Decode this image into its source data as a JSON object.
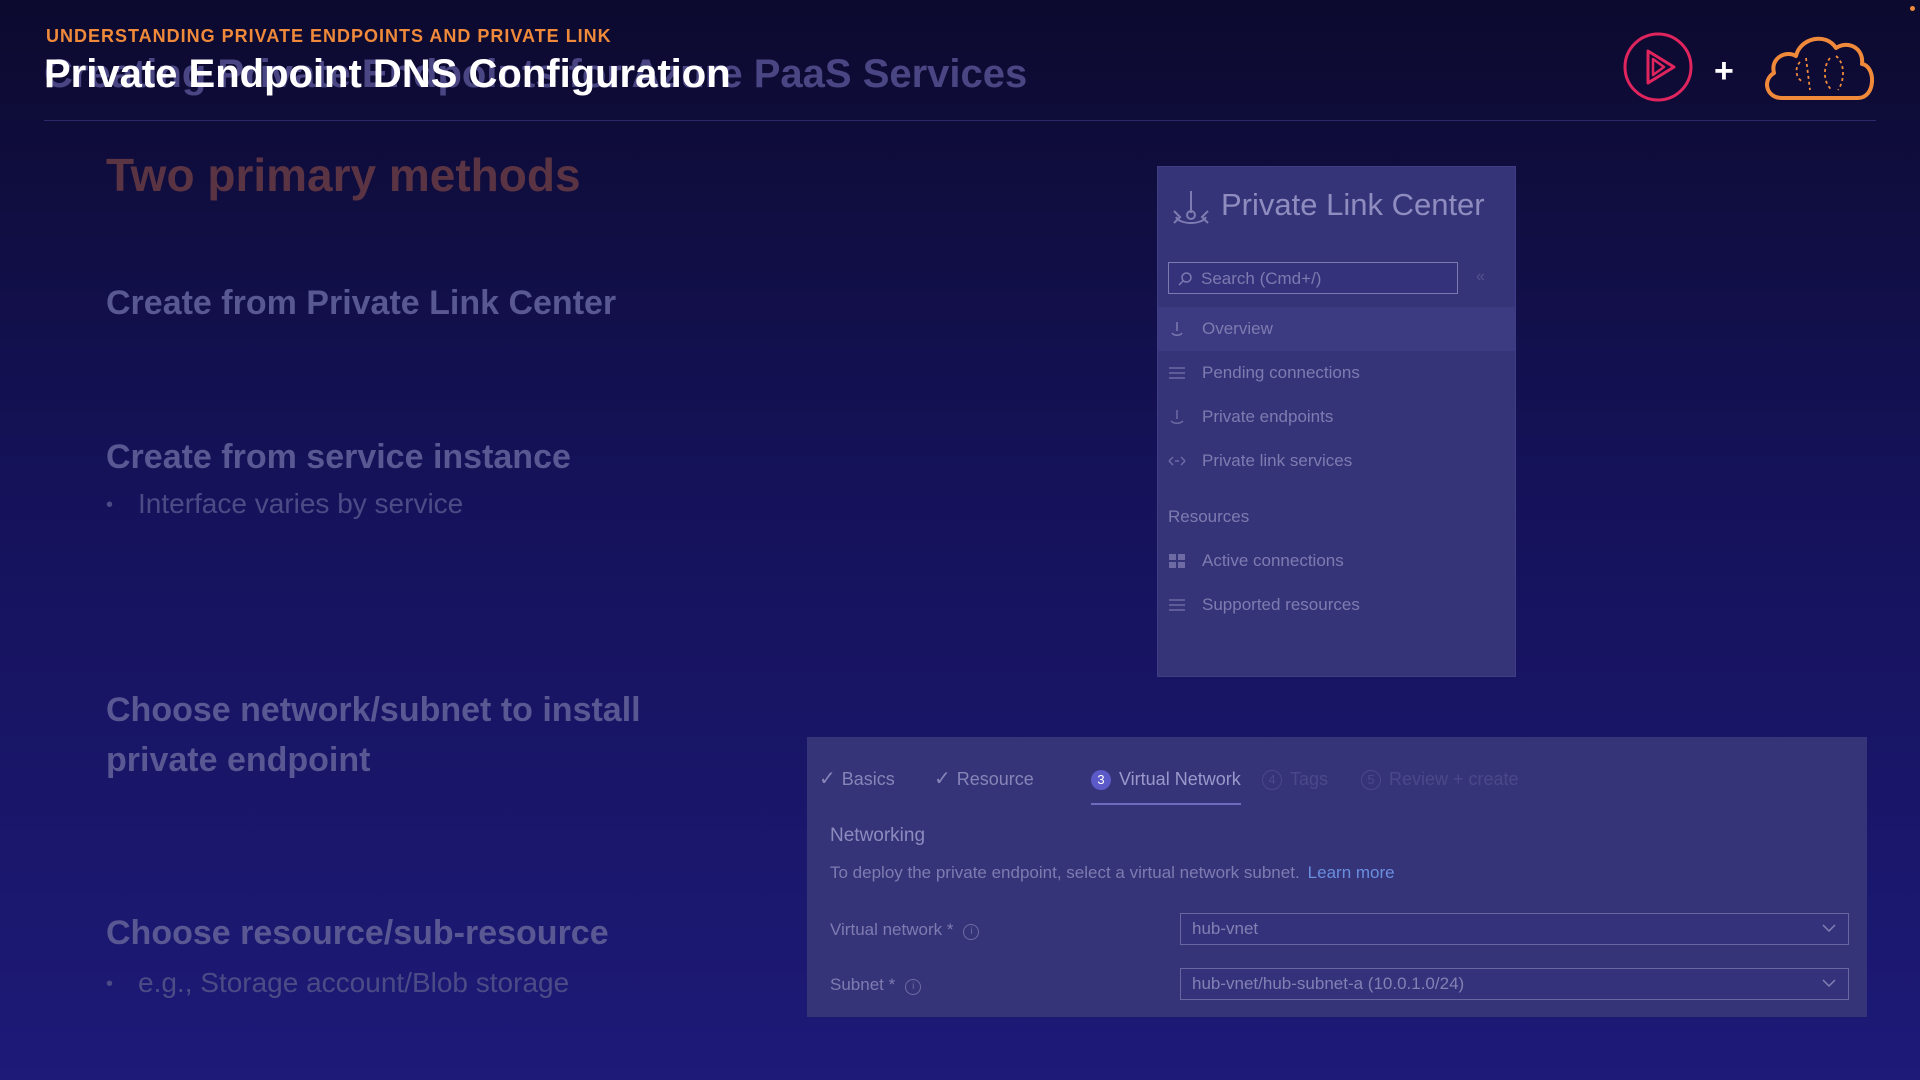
{
  "header": {
    "eyebrow": "UNDERSTANDING PRIVATE ENDPOINTS AND PRIVATE LINK",
    "title_ghost": "Creating Private Endpoints for Azure PaaS Services",
    "title": "Private Endpoint DNS Configuration"
  },
  "logos": [
    "play-logo-icon",
    "plus-icon",
    "cloud-brain-icon"
  ],
  "slide": {
    "section_heading": "Two primary methods",
    "items": [
      {
        "text": "Create from Private Link Center"
      },
      {
        "text": "Create from service instance",
        "bullet": "Interface varies by service"
      },
      {
        "text_line1": "Choose network/subnet to install",
        "text_line2": "private endpoint"
      },
      {
        "text": "Choose resource/sub-resource",
        "bullet": "e.g., Storage account/Blob storage"
      }
    ]
  },
  "private_link_center": {
    "title": "Private Link Center",
    "search_placeholder": "Search (Cmd+/)",
    "collapse_label": "«",
    "nav": [
      {
        "label": "Overview",
        "icon": "overview-icon",
        "active": true
      },
      {
        "label": "Pending connections",
        "icon": "list-icon"
      },
      {
        "label": "Private endpoints",
        "icon": "endpoint-icon"
      },
      {
        "label": "Private link services",
        "icon": "link-icon"
      }
    ],
    "resources_heading": "Resources",
    "resources": [
      {
        "label": "Active connections",
        "icon": "grid-icon"
      },
      {
        "label": "Supported resources",
        "icon": "list-icon"
      }
    ]
  },
  "create_endpoint": {
    "tabs": [
      {
        "label": "Basics",
        "state": "done"
      },
      {
        "label": "Resource",
        "state": "done"
      },
      {
        "label": "Virtual Network",
        "state": "active",
        "number": "3"
      },
      {
        "label": "Tags",
        "state": "upcoming",
        "number": "4"
      },
      {
        "label": "Review + create",
        "state": "upcoming",
        "number": "5"
      }
    ],
    "section_title": "Networking",
    "description": "To deploy the private endpoint, select a virtual network subnet.",
    "learn_more": "Learn more",
    "fields": [
      {
        "label": "Virtual network *",
        "value": "hub-vnet"
      },
      {
        "label": "Subnet *",
        "value": "hub-vnet/hub-subnet-a (10.0.1.0/24)"
      }
    ]
  },
  "colors": {
    "accent_orange": "#f08a3a",
    "accent_magenta": "#e0245e",
    "background": "#15125a"
  }
}
